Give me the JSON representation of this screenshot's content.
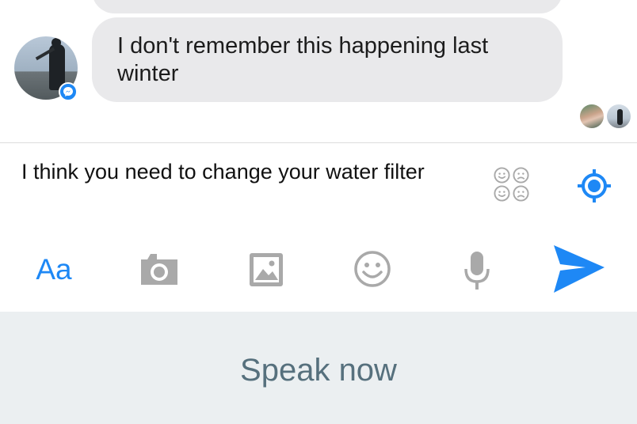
{
  "conversation": {
    "previous_message": "",
    "message": "I don't remember this happening last winter"
  },
  "composer": {
    "text": "I think you need to change your water filter"
  },
  "toolbar": {
    "aa_label": "Aa",
    "icons": [
      "aa-text-icon",
      "camera-icon",
      "gallery-icon",
      "emoji-icon",
      "microphone-icon",
      "send-icon"
    ]
  },
  "voice": {
    "prompt": "Speak now"
  },
  "colors": {
    "accent": "#1e88f5",
    "bubble": "#e9e9eb",
    "icon_gray": "#a9a9a9",
    "panel": "#ebeff1",
    "panel_text": "#56707d"
  }
}
